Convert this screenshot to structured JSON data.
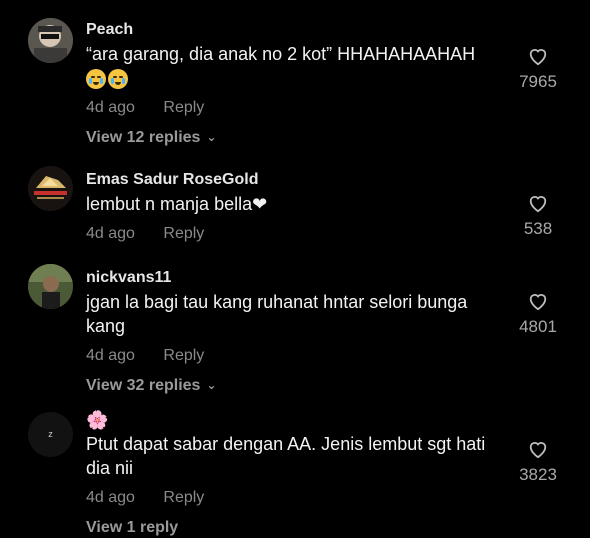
{
  "comments": [
    {
      "username": "Peach",
      "text": "“ara garang, dia anak no 2 kot” HHAHAHAAHAH",
      "time": "4d ago",
      "reply_label": "Reply",
      "likes": "7965",
      "view_replies": "View 12 replies"
    },
    {
      "username": "Emas Sadur RoseGold",
      "text": "lembut n manja bella❤",
      "time": "4d ago",
      "reply_label": "Reply",
      "likes": "538"
    },
    {
      "username": "nickvans11",
      "text": "jgan la bagi tau kang ruhanat hntar selori bunga kang",
      "time": "4d ago",
      "reply_label": "Reply",
      "likes": "4801",
      "view_replies": "View 32 replies"
    },
    {
      "username": "🌸",
      "text": "Ptut dapat sabar dengan AA. Jenis lembut sgt hati dia nii",
      "time": "4d ago",
      "reply_label": "Reply",
      "likes": "3823",
      "view_replies": "View 1 reply"
    }
  ],
  "avatar4_letter": "z"
}
